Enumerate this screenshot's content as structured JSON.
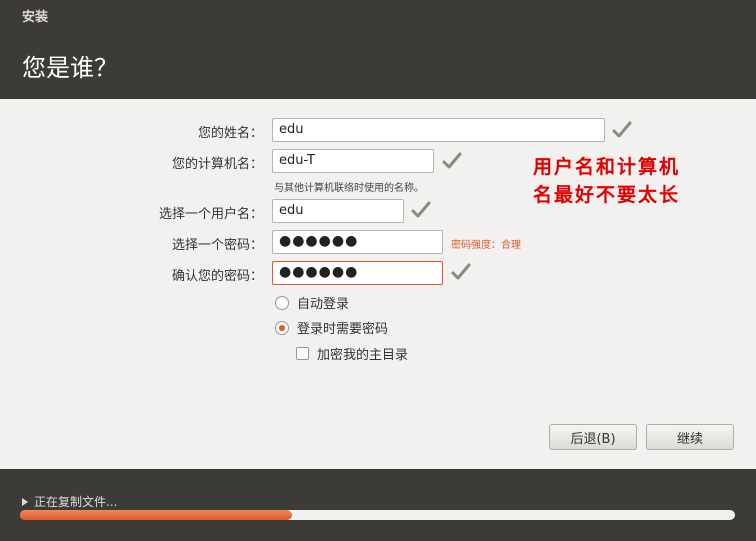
{
  "window": {
    "title": "安装"
  },
  "page": {
    "heading": "您是谁？"
  },
  "form": {
    "name_label": "您的姓名：",
    "name_value": "edu",
    "computer_label": "您的计算机名：",
    "computer_value": "edu-T",
    "computer_hint": "与其他计算机联络时使用的名称。",
    "username_label": "选择一个用户名：",
    "username_value": "edu",
    "password_label": "选择一个密码：",
    "password_value": "●●●●●●",
    "password_strength": "密码强度：合理",
    "confirm_label": "确认您的密码：",
    "confirm_value": "●●●●●●"
  },
  "options": {
    "auto_login": "自动登录",
    "require_password": "登录时需要密码",
    "encrypt_home": "加密我的主目录",
    "selected": "require_password"
  },
  "annotation": {
    "line1": "用户名和计算机",
    "line2": "名最好不要太长"
  },
  "buttons": {
    "back": "后退(B)",
    "continue": "继续"
  },
  "footer": {
    "status": "正在复制文件...",
    "progress_percent": 38
  },
  "colors": {
    "accent": "#e1582b",
    "annotation": "#e00000",
    "dark_bg": "#3c3b37",
    "check_icon": "#8c8a7f"
  }
}
